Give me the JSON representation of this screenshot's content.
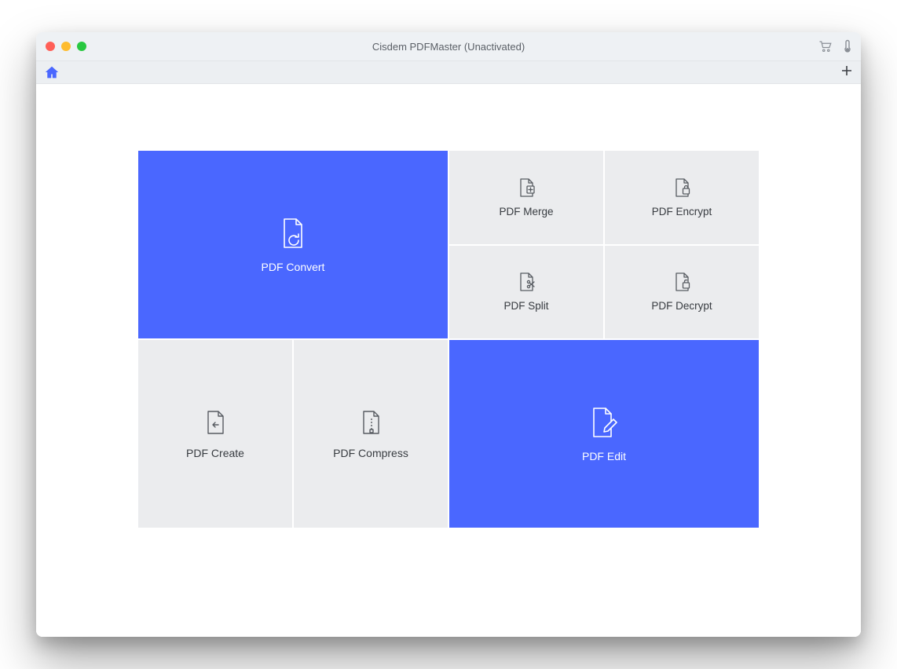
{
  "window": {
    "title": "Cisdem PDFMaster (Unactivated)"
  },
  "colors": {
    "accent": "#4a67ff",
    "tile_gray": "#ebecee"
  },
  "titlebar_icons": {
    "cart": "cart-icon",
    "thermometer": "thermometer-icon"
  },
  "tiles": {
    "convert": {
      "label": "PDF Convert",
      "highlight": true,
      "icon": "file-convert-icon"
    },
    "merge": {
      "label": "PDF Merge",
      "highlight": false,
      "icon": "file-merge-icon"
    },
    "encrypt": {
      "label": "PDF Encrypt",
      "highlight": false,
      "icon": "file-lock-icon"
    },
    "split": {
      "label": "PDF Split",
      "highlight": false,
      "icon": "file-split-icon"
    },
    "decrypt": {
      "label": "PDF Decrypt",
      "highlight": false,
      "icon": "file-unlock-icon"
    },
    "create": {
      "label": "PDF Create",
      "highlight": false,
      "icon": "file-create-icon"
    },
    "compress": {
      "label": "PDF Compress",
      "highlight": false,
      "icon": "file-compress-icon"
    },
    "edit": {
      "label": "PDF Edit",
      "highlight": true,
      "icon": "file-edit-icon"
    }
  }
}
